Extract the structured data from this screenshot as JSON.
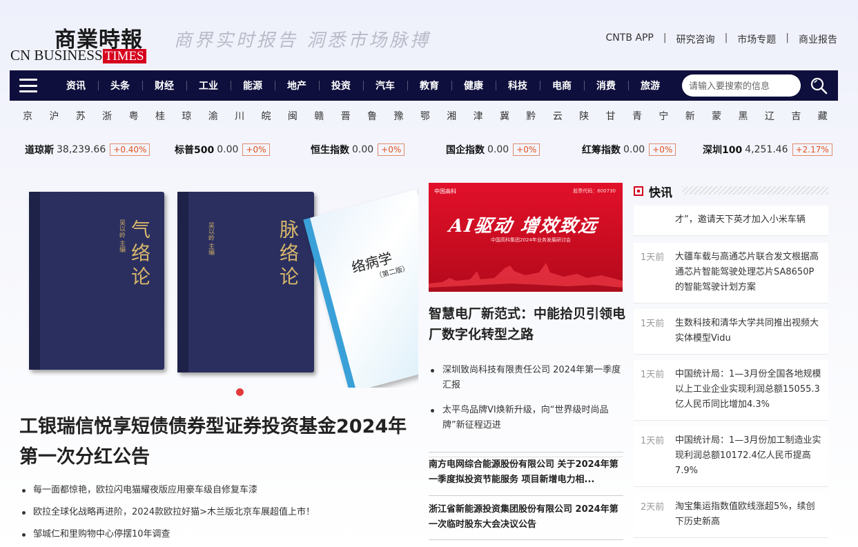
{
  "header": {
    "logo_cn": "商業時報",
    "logo_en_prefix": "CN BUSINESS",
    "logo_en_suffix": "TIMES",
    "slogan": "商界实时报告 洞悉市场脉搏",
    "top_links": [
      "CNTB APP",
      "研究咨询",
      "市场专题",
      "商业报告"
    ]
  },
  "nav": {
    "items": [
      "资讯",
      "头条",
      "财经",
      "工业",
      "能源",
      "地产",
      "投资",
      "汽车",
      "教育",
      "健康",
      "科技",
      "电商",
      "消费",
      "旅游"
    ],
    "search_placeholder": "请输入要搜索的信息"
  },
  "provinces": [
    "京",
    "沪",
    "苏",
    "浙",
    "粤",
    "桂",
    "琼",
    "渝",
    "川",
    "皖",
    "闽",
    "赣",
    "晋",
    "鲁",
    "豫",
    "鄂",
    "湘",
    "津",
    "冀",
    "黔",
    "云",
    "陕",
    "甘",
    "青",
    "宁",
    "新",
    "蒙",
    "黑",
    "辽",
    "吉",
    "藏"
  ],
  "indices": [
    {
      "name": "道琼斯",
      "value": "38,239.66",
      "change": "+0.40%"
    },
    {
      "name": "标普500",
      "value": "0.00",
      "change": "+0%"
    },
    {
      "name": "恒生指数",
      "value": "0.00",
      "change": "+0%"
    },
    {
      "name": "国企指数",
      "value": "0.00",
      "change": "+0%"
    },
    {
      "name": "红筹指数",
      "value": "0.00",
      "change": "+0%"
    },
    {
      "name": "深圳100",
      "value": "4,251.46",
      "change": "+2.17%"
    }
  ],
  "slider": {
    "books": [
      {
        "title": "气络论",
        "author": "吴以岭 主编"
      },
      {
        "title": "脉络论",
        "author": "吴以岭 主编"
      },
      {
        "title": "络病学",
        "subtitle": "（第二版）"
      }
    ]
  },
  "main": {
    "headline": "工银瑞信悦享短债债券型证券投资基金2024年第一次分红公告",
    "sub_items": [
      "每一面都惊艳，欧拉闪电猫耀夜版应用豪车级自修复车漆",
      "欧拉全球化战略再进阶，2024款欧拉好猫>木兰版北京车展超值上市！",
      "邹城仁和里购物中心停摆10年调查"
    ]
  },
  "middle": {
    "banner": {
      "brand": "中国高科",
      "code": "股票代码：600730",
      "slogan": "AI驱动 增效致远",
      "meeting": "中国高科集团2024年业务发展研讨会"
    },
    "title": "智慧电厂新范式：中能拾贝引领电厂数字化转型之路",
    "list": [
      "深圳致尚科技有限责任公司 2024年第一季度汇报",
      "太平鸟品牌VI焕新升级，向“世界级时尚品牌”新征程迈进"
    ],
    "news": [
      "南方电网综合能源股份有限公司 关于2024年第一季度拟投资节能服务 项目新增电力相...",
      "浙江省新能源投资集团股份有限公司 2024年第一次临时股东大会决议公告"
    ]
  },
  "flash": {
    "title": "快讯",
    "items": [
      {
        "time": "",
        "text": "才”，邀请天下英才加入小米车辆"
      },
      {
        "time": "1天前",
        "text": "大疆车载与高通芯片联合发文根据高通芯片智能驾驶处理芯片SA8650P的智能驾驶计划方案"
      },
      {
        "time": "1天前",
        "text": "生数科技和清华大学共同推出视频大实体模型Vidu"
      },
      {
        "time": "1天前",
        "text": "中国统计局：1—3月份全国各地规模以上工业企业实现利润总额15055.3亿人民币同比增加4.3%"
      },
      {
        "time": "1天前",
        "text": "中国统计局：1—3月份加工制造业实现利润总额10172.4亿人民币提高7.9%"
      },
      {
        "time": "2天前",
        "text": "淘宝集运指数值欧线涨超5%，续创下历史新高"
      }
    ]
  },
  "colors": {
    "nav_bg": "#0f0f3d",
    "accent_red": "#d6001c",
    "change_orange": "#e0501f"
  }
}
